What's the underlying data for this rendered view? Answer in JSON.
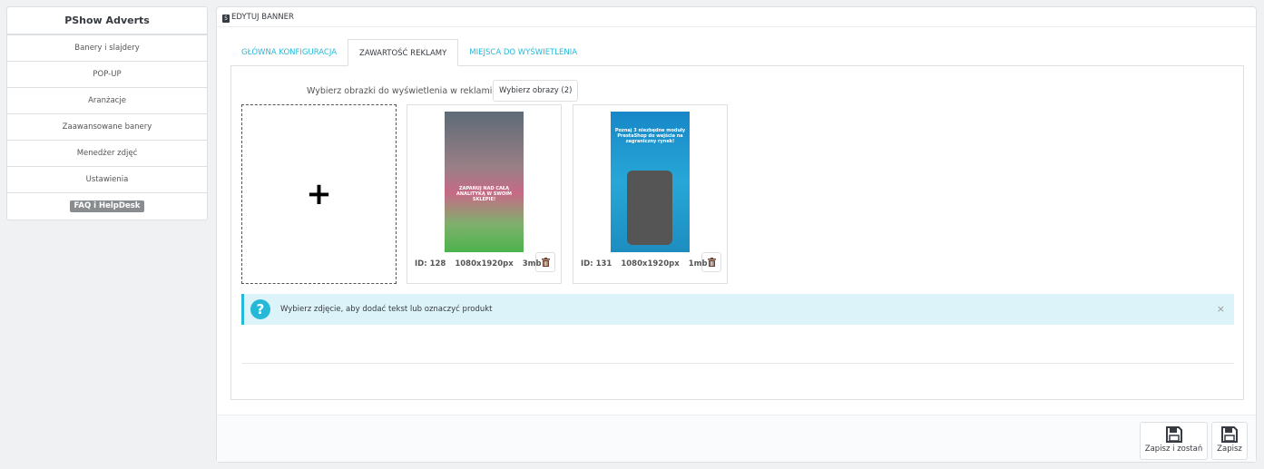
{
  "sidebar": {
    "title": "PShow Adverts",
    "items": [
      {
        "label": "Banery i slajdery"
      },
      {
        "label": "POP-UP"
      },
      {
        "label": "Aranżacje"
      },
      {
        "label": "Zaawansowane banery"
      },
      {
        "label": "Menedżer zdjęć"
      },
      {
        "label": "Ustawienia"
      }
    ],
    "faq": "FAQ i HelpDesk"
  },
  "panel": {
    "title": "EDYTUJ BANNER",
    "icon": "html5-icon"
  },
  "tabs": [
    {
      "label": "GŁÓWNA KONFIGURACJA",
      "active": false
    },
    {
      "label": "ZAWARTOŚĆ REKLAMY",
      "active": true
    },
    {
      "label": "MIEJSCA DO WYŚWIETLENIA",
      "active": false
    }
  ],
  "content": {
    "pick_label": "Wybierz obrazki do wyświetlenia w reklamie",
    "pick_button": "Wybierz obrazy (2)",
    "add_symbol": "+",
    "images": [
      {
        "id": "ID: 128",
        "dims": "1080x1920px",
        "size": "3mb",
        "headline": "ZAPANUJ NAD CAŁĄ ANALITYKĄ W SWOIM SKLEPIE!"
      },
      {
        "id": "ID: 131",
        "dims": "1080x1920px",
        "size": "1mb",
        "headline": "Poznaj 3 niezbędne moduły PrestaShop do wejścia na zagraniczny rynek!"
      }
    ],
    "alert": "Wybierz zdjęcie, aby dodać tekst lub oznaczyć produkt",
    "alert_close": "×"
  },
  "footer": {
    "save_stay": "Zapisz i zostań",
    "save": "Zapisz"
  },
  "colors": {
    "accent": "#25b9d7",
    "alert_bg": "#dcf4f9",
    "text": "#363a41"
  }
}
